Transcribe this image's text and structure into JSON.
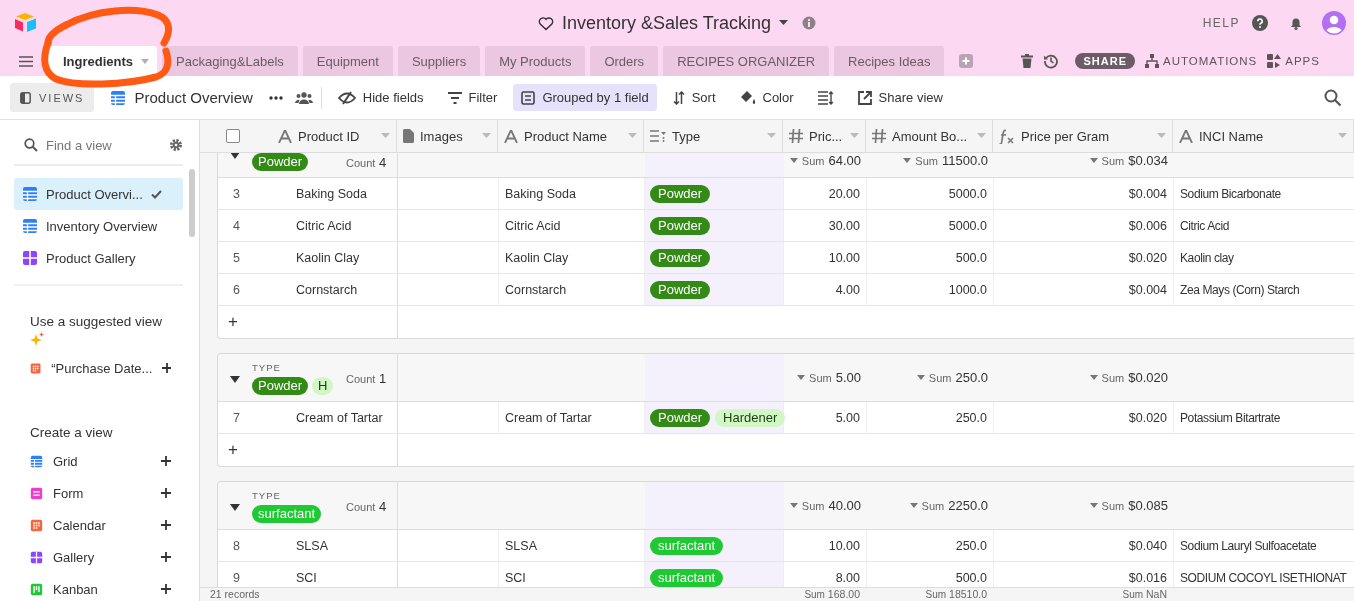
{
  "app": {
    "title": "Inventory &Sales Tracking",
    "help": "HELP"
  },
  "tabs": [
    {
      "label": "Ingredients",
      "selected": true
    },
    {
      "label": "Packaging&Labels",
      "selected": false
    },
    {
      "label": "Equipment",
      "selected": false
    },
    {
      "label": "Suppliers",
      "selected": false
    },
    {
      "label": "My Products",
      "selected": false
    },
    {
      "label": "Orders",
      "selected": false
    },
    {
      "label": "RECIPES ORGANIZER",
      "selected": false
    },
    {
      "label": "Recipes Ideas",
      "selected": false
    }
  ],
  "tab_actions": {
    "share": "SHARE",
    "automations": "AUTOMATIONS",
    "apps": "APPS"
  },
  "annotations": [
    {
      "kind": "freehand-circle"
    }
  ],
  "toolbar": {
    "views": "VIEWS",
    "view_name": "Product Overview",
    "buttons": [
      {
        "kind": "hide",
        "label": "Hide fields",
        "active": false
      },
      {
        "kind": "filter",
        "label": "Filter",
        "active": false
      },
      {
        "kind": "group",
        "label": "Grouped by 1 field",
        "active": true
      },
      {
        "kind": "sort",
        "label": "Sort",
        "active": false
      },
      {
        "kind": "color",
        "label": "Color",
        "active": false
      },
      {
        "kind": "rowheight",
        "active": false
      },
      {
        "kind": "share",
        "label": "Share view",
        "active": false
      }
    ]
  },
  "sidebar": {
    "search": {
      "placeholder": "Find a view"
    },
    "views": [
      {
        "label": "Product Overvi...",
        "kind": "grid",
        "selected": true
      },
      {
        "label": "Inventory Overview",
        "kind": "grid",
        "selected": false
      },
      {
        "label": "Product Gallery",
        "kind": "gallery",
        "selected": false
      }
    ],
    "suggested_title": "Use a suggested view",
    "suggested": [
      {
        "label": "“Purchase Date...",
        "kind": "calendar"
      }
    ],
    "create_title": "Create a view",
    "create": [
      {
        "label": "Grid",
        "kind": "grid"
      },
      {
        "label": "Form",
        "kind": "form"
      },
      {
        "label": "Calendar",
        "kind": "calendar"
      },
      {
        "label": "Gallery",
        "kind": "gallery"
      },
      {
        "label": "Kanban",
        "kind": "kanban"
      }
    ]
  },
  "table": {
    "select_all_checked": false,
    "columns": [
      {
        "label": "Product ID",
        "kind": "text"
      },
      {
        "label": "Images",
        "kind": "attachment"
      },
      {
        "label": "Product Name",
        "kind": "text"
      },
      {
        "label": "Type",
        "kind": "multiselect"
      },
      {
        "label": "Pric...",
        "kind": "number"
      },
      {
        "label": "Amount Bo...",
        "kind": "number"
      },
      {
        "label": "Price per Gram",
        "kind": "formula"
      },
      {
        "label": "INCI Name",
        "kind": "text"
      }
    ],
    "groups": [
      {
        "tags": [
          {
            "label": "Powder",
            "color": "#338a17"
          }
        ],
        "count": {
          "label": "Count",
          "value": "4"
        },
        "sums": [
          {
            "label": "Sum",
            "value": "64.00"
          },
          {
            "label": "Sum",
            "value": "11500.0"
          },
          {
            "label": "Sum",
            "value": "$0.034"
          }
        ],
        "rows": [
          {
            "number": "3",
            "product_id": "Baking Soda",
            "product_name": "Baking Soda",
            "type": [
              {
                "label": "Powder",
                "color": "#338a17"
              }
            ],
            "price": "20.00",
            "amount": "5000.0",
            "price_per_gram": "$0.004",
            "inci": "Sodium Bicarbonate"
          },
          {
            "number": "4",
            "product_id": "Citric Acid",
            "product_name": "Citric Acid",
            "type": [
              {
                "label": "Powder",
                "color": "#338a17"
              }
            ],
            "price": "30.00",
            "amount": "5000.0",
            "price_per_gram": "$0.006",
            "inci": "Citric Acid"
          },
          {
            "number": "5",
            "product_id": "Kaolin Clay",
            "product_name": "Kaolin Clay",
            "type": [
              {
                "label": "Powder",
                "color": "#338a17"
              }
            ],
            "price": "10.00",
            "amount": "500.0",
            "price_per_gram": "$0.020",
            "inci": "Kaolin clay"
          },
          {
            "number": "6",
            "product_id": "Cornstarch",
            "product_name": "Cornstarch",
            "type": [
              {
                "label": "Powder",
                "color": "#338a17"
              }
            ],
            "price": "4.00",
            "amount": "1000.0",
            "price_per_gram": "$0.004",
            "inci": "Zea Mays (Corn) Starch"
          }
        ],
        "add": "+"
      },
      {
        "type_label": "TYPE",
        "tags": [
          {
            "label": "Powder",
            "color": "#338a17"
          },
          {
            "label": "H",
            "color": "#d1f7c4"
          }
        ],
        "count": {
          "label": "Count",
          "value": "1"
        },
        "sums": [
          {
            "label": "Sum",
            "value": "5.00"
          },
          {
            "label": "Sum",
            "value": "250.0"
          },
          {
            "label": "Sum",
            "value": "$0.020"
          }
        ],
        "rows": [
          {
            "number": "7",
            "product_id": "Cream of Tartar",
            "product_name": "Cream of Tartar",
            "type": [
              {
                "label": "Powder",
                "color": "#338a17"
              },
              {
                "label": "Hardener",
                "color": "#d1f7c4"
              }
            ],
            "price": "5.00",
            "amount": "250.0",
            "price_per_gram": "$0.020",
            "inci": "Potassium Bitartrate"
          }
        ],
        "add": "+"
      },
      {
        "type_label": "TYPE",
        "tags": [
          {
            "label": "surfactant",
            "color": "#20c933"
          }
        ],
        "count": {
          "label": "Count",
          "value": "4"
        },
        "sums": [
          {
            "label": "Sum",
            "value": "40.00"
          },
          {
            "label": "Sum",
            "value": "2250.0"
          },
          {
            "label": "Sum",
            "value": "$0.085"
          }
        ],
        "rows": [
          {
            "number": "8",
            "product_id": "SLSA",
            "product_name": "SLSA",
            "type": [
              {
                "label": "surfactant",
                "color": "#20c933"
              }
            ],
            "price": "10.00",
            "amount": "250.0",
            "price_per_gram": "$0.040",
            "inci": "Sodium Lauryl Sulfoacetate"
          },
          {
            "number": "9",
            "product_id": "SCI",
            "product_name": "SCI",
            "type": [
              {
                "label": "surfactant",
                "color": "#20c933"
              }
            ],
            "price": "8.00",
            "amount": "500.0",
            "price_per_gram": "$0.016",
            "inci": "SODIUM COCOYL ISETHIONAT"
          }
        ]
      }
    ],
    "footer": {
      "records": "21 records",
      "sums": [
        {
          "label": "Sum",
          "value": "168.00"
        },
        {
          "label": "Sum",
          "value": "18510.0"
        },
        {
          "label": "Sum",
          "value": "NaN"
        }
      ]
    }
  }
}
